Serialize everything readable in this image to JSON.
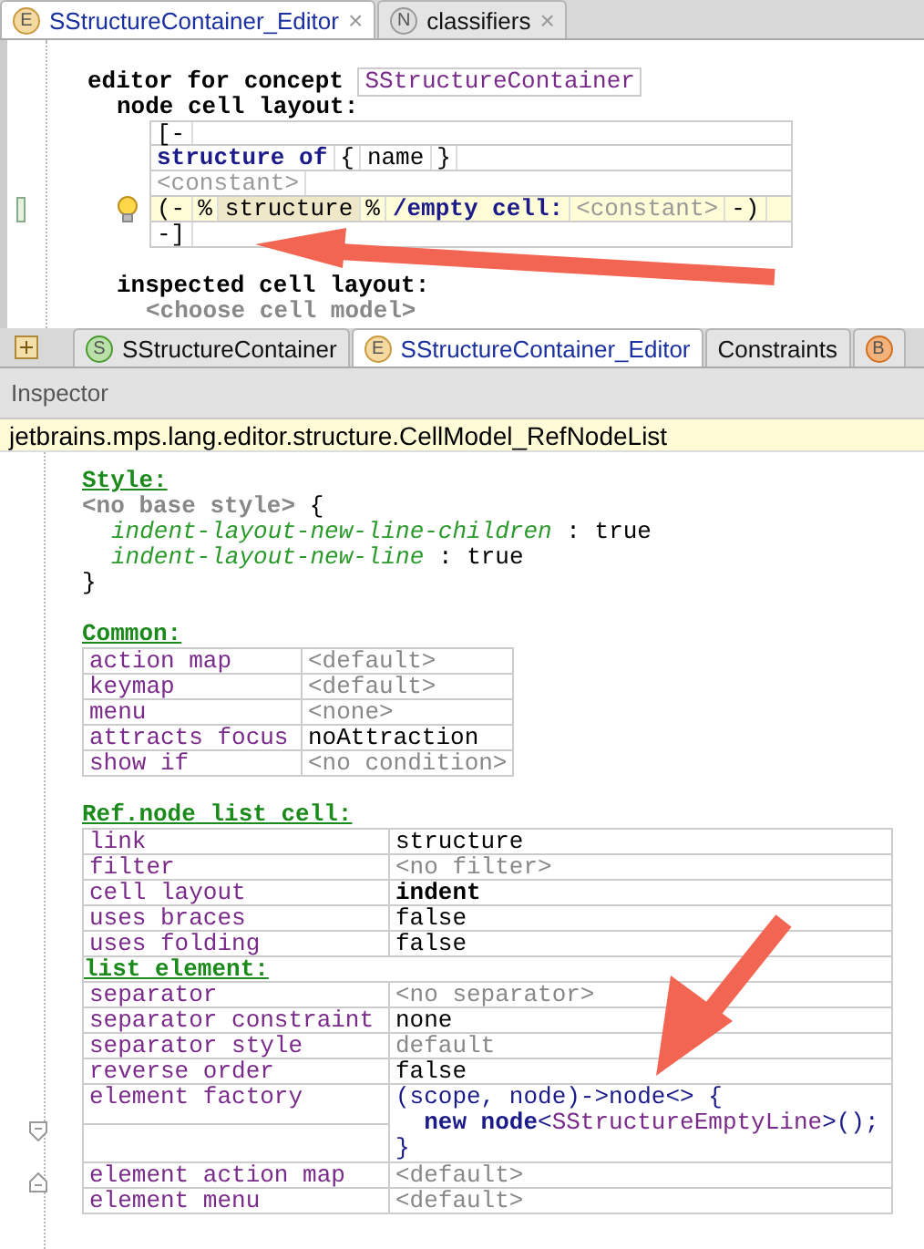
{
  "editor_tabs": [
    {
      "icon": "E",
      "label": "SStructureContainer_Editor",
      "close": "×",
      "selected": true
    },
    {
      "icon": "N",
      "label": "classifiers",
      "close": "×",
      "selected": false
    }
  ],
  "editor": {
    "header": "editor for concept",
    "concept": "SStructureContainer",
    "layout_label": "node cell layout:",
    "open": "[-",
    "close": "-]",
    "lines": [
      {
        "selected": false,
        "tokens": [
          {
            "text": "structure of",
            "kind": "keyword",
            "selected": false
          },
          {
            "text": "{",
            "kind": "plain",
            "selected": false
          },
          {
            "text": "name",
            "kind": "plain",
            "selected": false
          },
          {
            "text": "}",
            "kind": "plain",
            "selected": false
          }
        ]
      },
      {
        "selected": false,
        "tokens": [
          {
            "text": "<constant>",
            "kind": "placeholder",
            "selected": false
          }
        ]
      },
      {
        "selected": true,
        "tokens": [
          {
            "text": "(-",
            "kind": "plain",
            "selected": false
          },
          {
            "text": "%",
            "kind": "plain",
            "selected": false
          },
          {
            "text": "structure",
            "kind": "plain",
            "selected": true
          },
          {
            "text": "%",
            "kind": "plain",
            "selected": false
          },
          {
            "text": "/empty cell:",
            "kind": "keyword",
            "selected": false
          },
          {
            "text": "<constant>",
            "kind": "placeholder",
            "selected": false
          },
          {
            "text": "-)",
            "kind": "plain",
            "selected": false
          }
        ]
      }
    ],
    "inspected_label": "inspected cell layout:",
    "inspected_value": "<choose cell model>"
  },
  "bottom_tabs": [
    {
      "icon": "S",
      "label": "SStructureContainer",
      "selected": false
    },
    {
      "icon": "E",
      "label": "SStructureContainer_Editor",
      "selected": true
    },
    {
      "label": "Constraints",
      "selected": false
    },
    {
      "icon": "B",
      "selected": false
    }
  ],
  "inspector": {
    "title": "Inspector",
    "concept_path": "jetbrains.mps.lang.editor.structure.CellModel_RefNodeList",
    "style": {
      "title": "Style:",
      "base": "<no base style>",
      "open": "{",
      "close": "}",
      "entries": [
        {
          "name": "indent-layout-new-line-children",
          "sep": ":",
          "value": "true"
        },
        {
          "name": "indent-layout-new-line",
          "sep": ":",
          "value": "true"
        }
      ]
    },
    "common": {
      "title": "Common:",
      "rows": [
        {
          "key": "action map",
          "value": "<default>",
          "kind": "placeholder"
        },
        {
          "key": "keymap",
          "value": "<default>",
          "kind": "placeholder"
        },
        {
          "key": "menu",
          "value": "<none>",
          "kind": "placeholder"
        },
        {
          "key": "attracts focus",
          "value": "noAttraction",
          "kind": "plain"
        },
        {
          "key": "show if",
          "value": "<no condition>",
          "kind": "placeholder"
        }
      ]
    },
    "ref_node_list": {
      "title": "Ref.node list cell:",
      "rows": [
        {
          "kind": "plain",
          "key": "link",
          "value": "structure"
        },
        {
          "kind": "placeholder",
          "key": "filter",
          "value": "<no filter>"
        },
        {
          "kind": "bold",
          "key": "cell layout",
          "value": "indent"
        },
        {
          "kind": "plain",
          "key": "uses braces",
          "value": "false"
        },
        {
          "kind": "plain",
          "key": "uses folding",
          "value": "false"
        },
        {
          "kind": "heading",
          "text": "list element:"
        },
        {
          "kind": "placeholder",
          "key": "separator",
          "value": "<no separator>"
        },
        {
          "kind": "plain",
          "key": "separator constraint",
          "value": "none"
        },
        {
          "kind": "placeholder",
          "key": "separator style",
          "value": "default"
        },
        {
          "kind": "plain",
          "key": "reverse order",
          "value": "false"
        },
        {
          "kind": "code",
          "key": "element factory",
          "lines": [
            [
              {
                "text": "(scope, node)->node<> {",
                "kind": "plain"
              }
            ],
            [
              {
                "text": "  new node",
                "kind": "keyword"
              },
              {
                "text": "<",
                "kind": "plain"
              },
              {
                "text": "SStructureEmptyLine",
                "kind": "concept"
              },
              {
                "text": ">();",
                "kind": "plain"
              }
            ],
            [
              {
                "text": "}",
                "kind": "plain"
              }
            ]
          ]
        },
        {
          "kind": "placeholder",
          "key": "element action map",
          "value": "<default>"
        },
        {
          "kind": "placeholder",
          "key": "element menu",
          "value": "<default>"
        }
      ]
    }
  }
}
